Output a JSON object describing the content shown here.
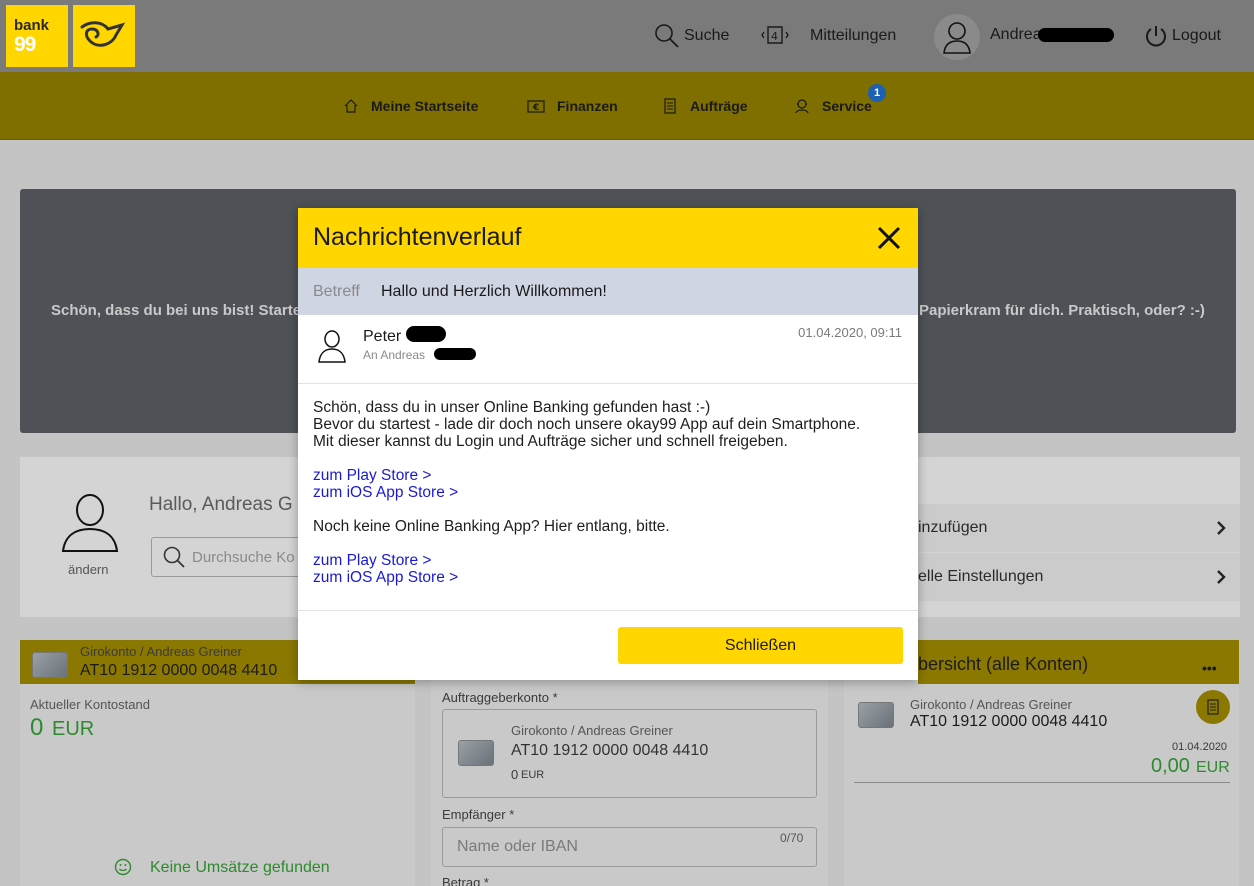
{
  "header": {
    "logo_line1": "bank",
    "logo_line2": "99",
    "search": "Suche",
    "messages": "Mitteilungen",
    "user_name": "Andreas",
    "logout": "Logout"
  },
  "nav": {
    "items": [
      {
        "label": "Meine Startseite",
        "icon": "home-icon"
      },
      {
        "label": "Finanzen",
        "icon": "finance-icon"
      },
      {
        "label": "Aufträge",
        "icon": "orders-icon"
      },
      {
        "label": "Service",
        "icon": "service-icon"
      }
    ],
    "service_badge": "1"
  },
  "banner": {
    "text_left": "Schön, dass du bei uns bist! Starte",
    "text_right": "Papierkram für dich. Praktisch, oder? :-)"
  },
  "profile": {
    "hello": "Hallo, Andreas G",
    "change": "ändern",
    "search_placeholder": "Durchsuche Ko",
    "settings_rows": [
      "inzufügen",
      "elle Einstellungen"
    ]
  },
  "account_card": {
    "title": "Girokonto / Andreas Greiner",
    "iban": "AT10 1912 0000 0048 4410",
    "balance_label": "Aktueller Kontostand",
    "balance_value": "0",
    "balance_currency": "EUR",
    "no_transactions": "Keine Umsätze gefunden"
  },
  "transfer_card": {
    "orderer_label": "Auftraggeberkonto *",
    "account_title": "Girokonto / Andreas Greiner",
    "iban": "AT10 1912 0000 0048 4410",
    "amount": "0",
    "currency": "EUR",
    "recipient_label": "Empfänger *",
    "recipient_placeholder": "Name oder IBAN",
    "recipient_counter": "0/70",
    "amount_label": "Betrag *"
  },
  "overview_card": {
    "title": "bersicht (alle Konten)",
    "more": "•••",
    "account_title": "Girokonto / Andreas Greiner",
    "iban": "AT10 1912 0000 0048 4410",
    "date": "01.04.2020",
    "amount": "0,00",
    "currency": "EUR"
  },
  "modal": {
    "title": "Nachrichtenverlauf",
    "subject_label": "Betreff",
    "subject": "Hallo und Herzlich Willkommen!",
    "sender": "Peter",
    "recipient": "An Andreas",
    "date": "01.04.2020, 09:11",
    "body_lines": [
      "Schön, dass du in unser Online Banking gefunden hast :-)",
      "Bevor du startest - lade dir doch noch unsere okay99 App auf dein Smartphone.",
      "Mit dieser kannst du Login und Aufträge sicher und schnell freigeben."
    ],
    "link_play_1": "zum Play Store >",
    "link_ios_1": "zum iOS App Store >",
    "no_app_text": "Noch keine Online Banking App? Hier entlang, bitte.",
    "link_play_2": "zum Play Store >",
    "link_ios_2": "zum iOS App Store >",
    "close_button": "Schließen"
  }
}
